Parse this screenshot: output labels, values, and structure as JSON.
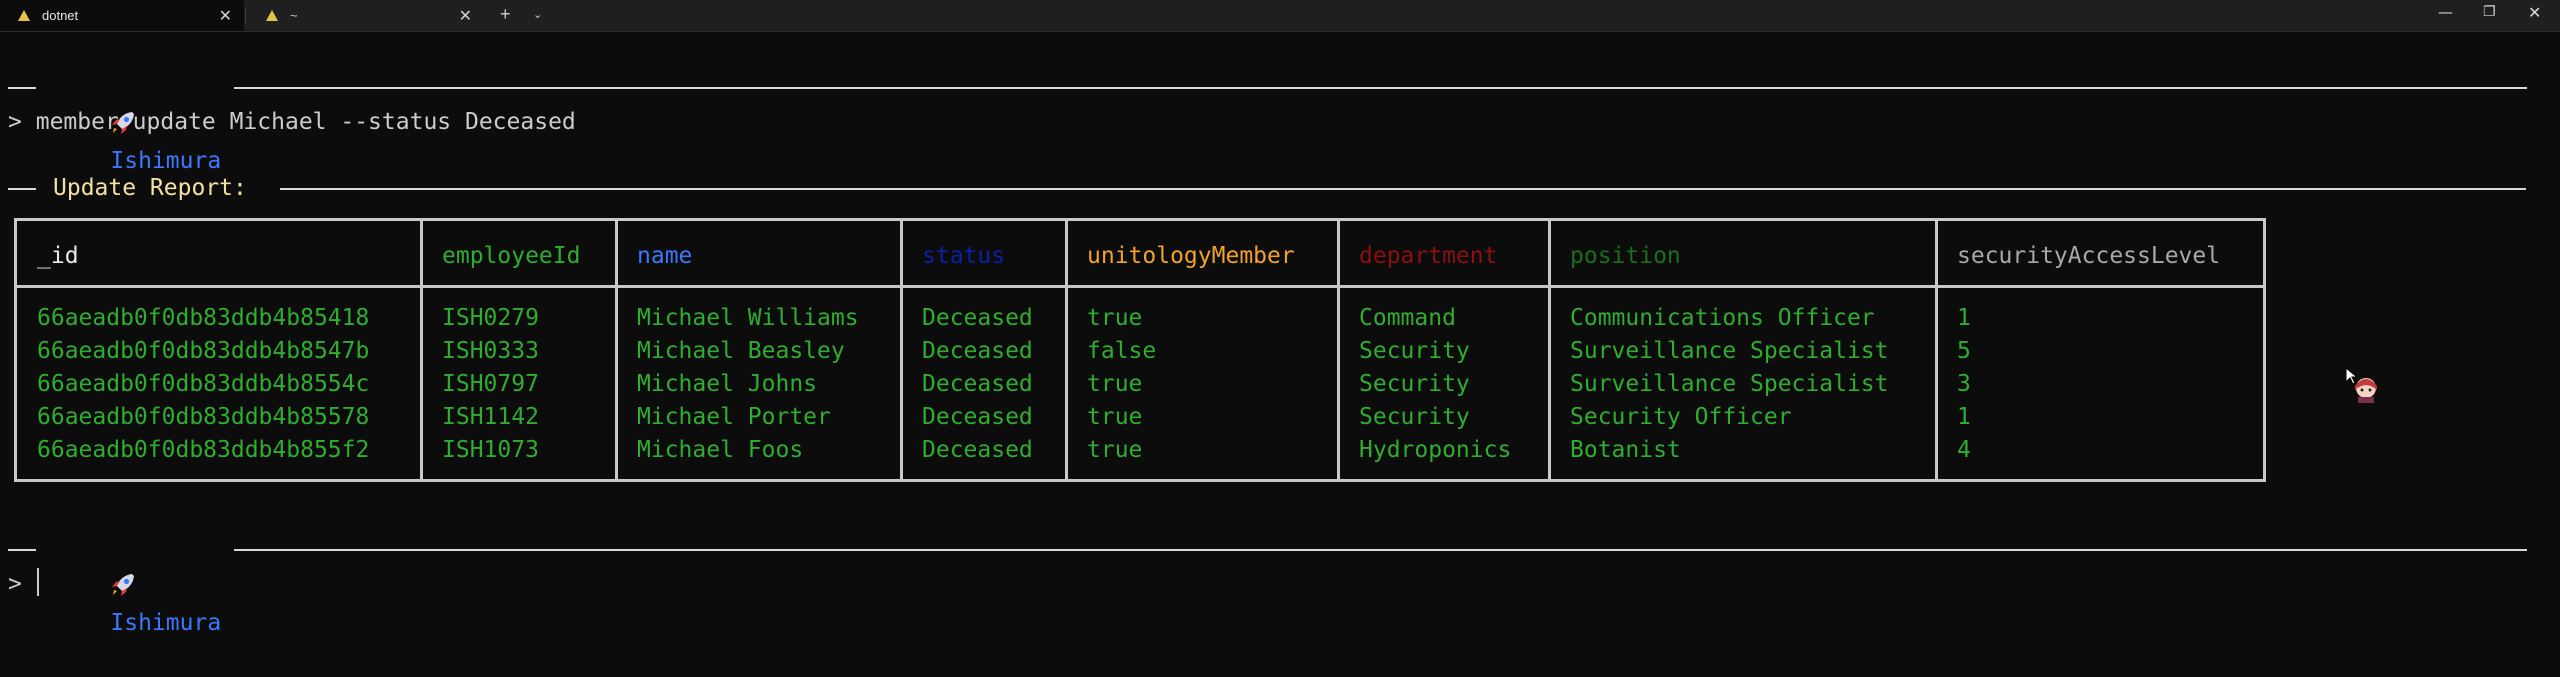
{
  "window": {
    "tabs": [
      {
        "label": "dotnet",
        "active": true
      },
      {
        "label": "~",
        "active": false
      }
    ],
    "new_tab": "+",
    "tab_dropdown": "⌄",
    "controls": {
      "minimize": "—",
      "maximize": "❐",
      "close": "✕"
    }
  },
  "terminal": {
    "header1": {
      "label": "Ishimura",
      "icon": "rocket-icon"
    },
    "prompt_symbol": ">",
    "command": "member update Michael --status Deceased",
    "report_title": "Update Report:",
    "table": {
      "columns": [
        {
          "key": "_id",
          "label": "_id",
          "color": "#e8e8e8"
        },
        {
          "key": "employeeId",
          "label": "employeeId",
          "color": "#2fad2f"
        },
        {
          "key": "name",
          "label": "name",
          "color": "#3b78ff"
        },
        {
          "key": "status",
          "label": "status",
          "color": "#0c1fa8"
        },
        {
          "key": "unitologyMember",
          "label": "unitologyMember",
          "color": "#f2a12b"
        },
        {
          "key": "department",
          "label": "department",
          "color": "#8b1010"
        },
        {
          "key": "position",
          "label": "position",
          "color": "#1a6e1a"
        },
        {
          "key": "securityAccessLevel",
          "label": "securityAccessLevel",
          "color": "#a8a8a8"
        }
      ],
      "rows": [
        [
          "66aeadb0f0db83ddb4b85418",
          "ISH0279",
          "Michael Williams",
          "Deceased",
          "true",
          "Command",
          "Communications Officer",
          "1"
        ],
        [
          "66aeadb0f0db83ddb4b8547b",
          "ISH0333",
          "Michael Beasley",
          "Deceased",
          "false",
          "Security",
          "Surveillance Specialist",
          "5"
        ],
        [
          "66aeadb0f0db83ddb4b8554c",
          "ISH0797",
          "Michael Johns",
          "Deceased",
          "true",
          "Security",
          "Surveillance Specialist",
          "3"
        ],
        [
          "66aeadb0f0db83ddb4b85578",
          "ISH1142",
          "Michael Porter",
          "Deceased",
          "true",
          "Security",
          "Security Officer",
          "1"
        ],
        [
          "66aeadb0f0db83ddb4b855f2",
          "ISH1073",
          "Michael Foos",
          "Deceased",
          "true",
          "Hydroponics",
          "Botanist",
          "4"
        ]
      ],
      "cell_color": "#2fad2f"
    },
    "header2": {
      "label": "Ishimura",
      "icon": "rocket-icon"
    },
    "colors": {
      "accent": "#3b78ff",
      "report_title": "#f0e2a0",
      "rule": "#d8d8d8",
      "background": "#0c0c0c"
    }
  }
}
